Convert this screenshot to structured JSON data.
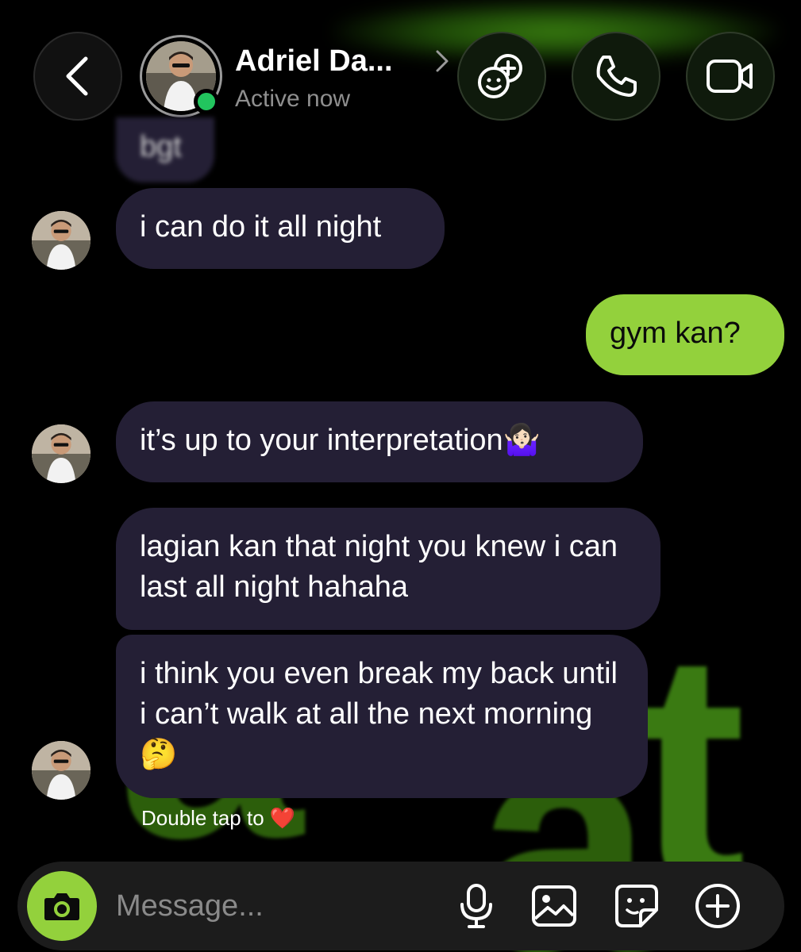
{
  "header": {
    "contact_name": "Adriel Da...",
    "status": "Active now",
    "status_color": "#22c55e"
  },
  "icons": {
    "back": "chevron-left-icon",
    "effects": "effects-icon",
    "call": "phone-icon",
    "video": "video-camera-icon",
    "camera": "camera-icon",
    "mic": "microphone-icon",
    "gallery": "image-icon",
    "sticker": "sticker-icon",
    "more": "plus-circle-icon"
  },
  "messages": [
    {
      "id": "m0",
      "direction": "in",
      "text": "bgt"
    },
    {
      "id": "m1",
      "direction": "in",
      "text": "i can do it all night"
    },
    {
      "id": "m2",
      "direction": "out",
      "text": "gym kan?"
    },
    {
      "id": "m3",
      "direction": "in",
      "text": "it’s up to your interpretation🤷🏻‍♀️"
    },
    {
      "id": "m4",
      "direction": "in",
      "text": "lagian kan that night you knew i can last all night hahaha"
    },
    {
      "id": "m5",
      "direction": "in",
      "text": "i think you even break my back until i can’t walk at all the next morning🤔"
    }
  ],
  "hint": "Double tap to ❤️",
  "composer": {
    "placeholder": "Message..."
  },
  "colors": {
    "accent": "#93d13c",
    "incoming_bubble": "#241f35",
    "background": "#000000"
  }
}
